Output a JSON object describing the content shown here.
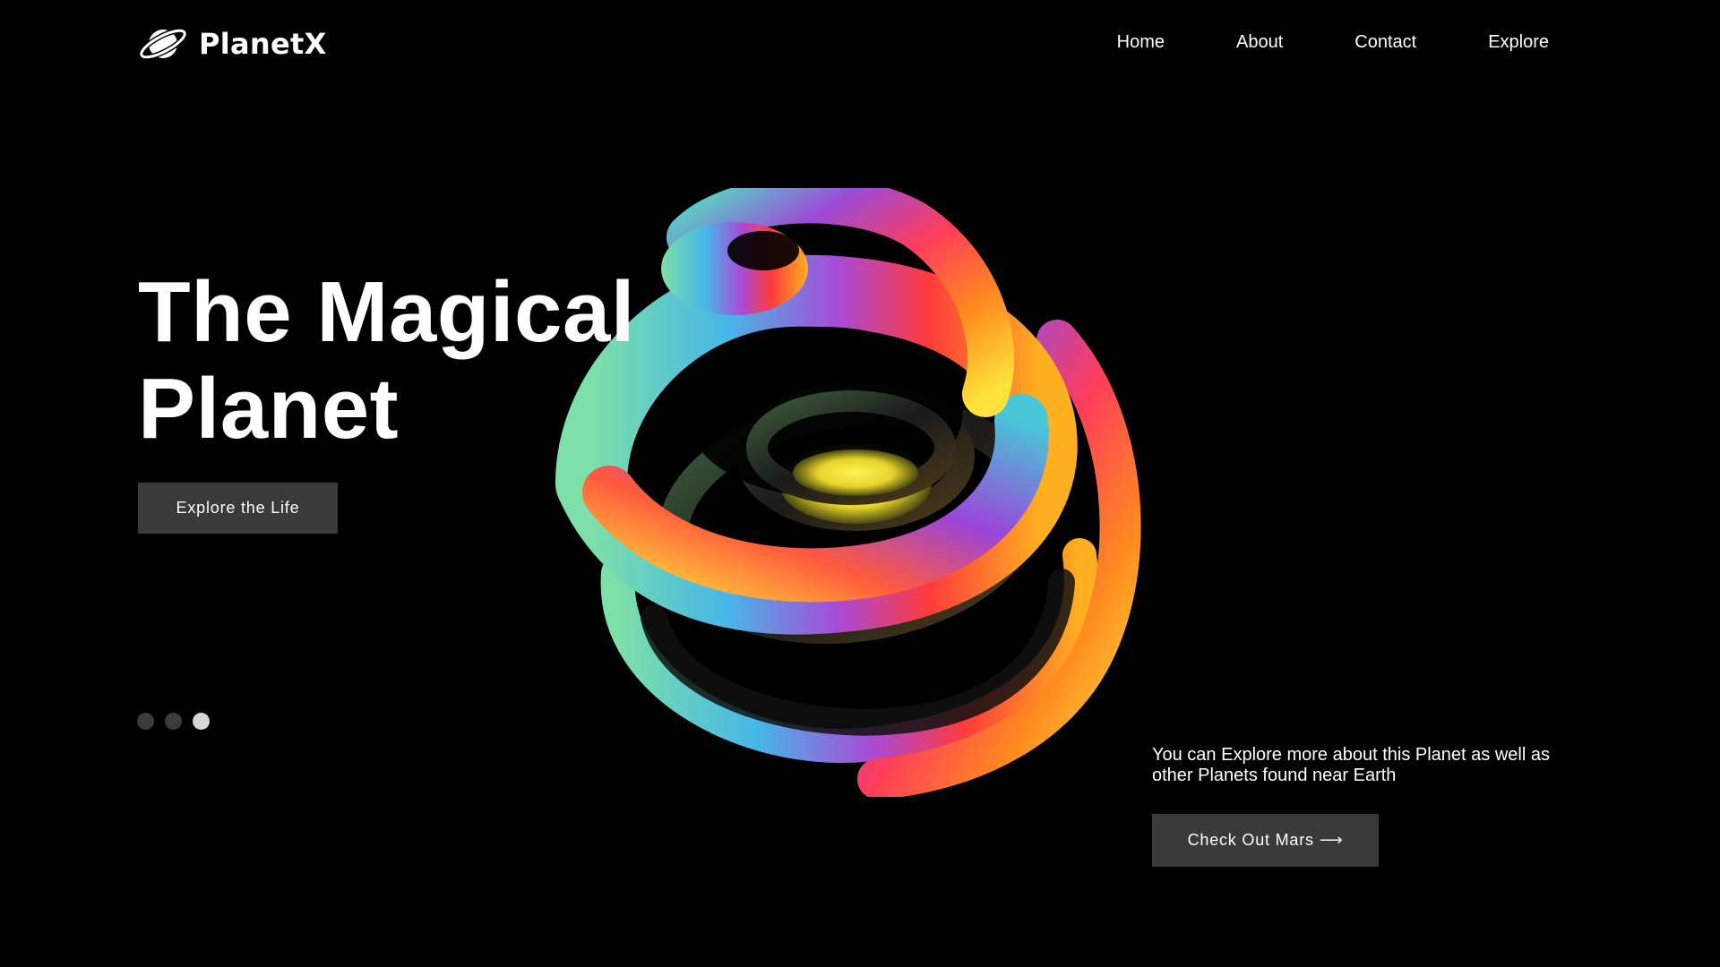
{
  "brand": {
    "name": "PlanetX",
    "icon": "planet-ring-icon"
  },
  "nav": {
    "items": [
      {
        "label": "Home"
      },
      {
        "label": "About"
      },
      {
        "label": "Contact"
      },
      {
        "label": "Explore"
      }
    ]
  },
  "hero": {
    "title_line1": "The Magical",
    "title_line2": "Planet",
    "cta_label": "Explore the Life",
    "image": "rainbow-swirl-planet"
  },
  "carousel": {
    "slide_count": 3,
    "active_index": 2
  },
  "info": {
    "text": "You can Explore more about this Planet as well as other Planets found near Earth",
    "cta_label": "Check Out Mars",
    "cta_icon": "arrow-right-icon",
    "cta_arrow": "⟶"
  },
  "colors": {
    "background": "#000000",
    "button": "#3a3a3a",
    "dot_inactive": "#3b3b3b",
    "dot_active": "#d6d6d6"
  }
}
